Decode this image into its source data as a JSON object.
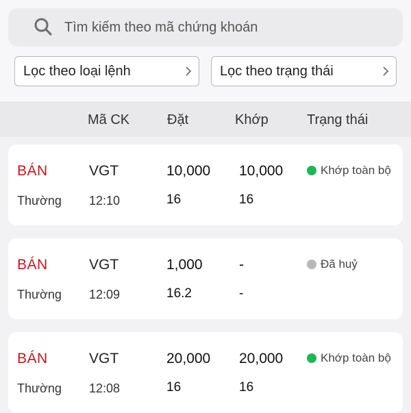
{
  "search": {
    "placeholder": "Tìm kiếm theo mã chứng khoán"
  },
  "filters": {
    "order_type_label": "Lọc theo loại lệnh",
    "status_label": "Lọc theo trạng thái"
  },
  "table_header": {
    "symbol": "Mã CK",
    "ordered": "Đặt",
    "matched": "Khớp",
    "status": "Trạng thái"
  },
  "orders": [
    {
      "side": "BÁN",
      "order_type": "Thường",
      "symbol": "VGT",
      "time": "12:10",
      "ordered_qty": "10,000",
      "ordered_price": "16",
      "matched_qty": "10,000",
      "matched_price": "16",
      "status": "Khớp toàn bộ",
      "status_color": "#1fb655"
    },
    {
      "side": "BÁN",
      "order_type": "Thường",
      "symbol": "VGT",
      "time": "12:09",
      "ordered_qty": "1,000",
      "ordered_price": "16.2",
      "matched_qty": "-",
      "matched_price": "-",
      "status": "Đã huỷ",
      "status_color": "#b8b8b8"
    },
    {
      "side": "BÁN",
      "order_type": "Thường",
      "symbol": "VGT",
      "time": "12:08",
      "ordered_qty": "20,000",
      "ordered_price": "16",
      "matched_qty": "20,000",
      "matched_price": "16",
      "status": "Khớp toàn bộ",
      "status_color": "#1fb655"
    }
  ],
  "colors": {
    "sell": "#c0181d",
    "matched": "#1fb655",
    "cancelled": "#b8b8b8"
  },
  "icons": {
    "search": "search-icon",
    "chevron": "chevron-right-icon"
  }
}
